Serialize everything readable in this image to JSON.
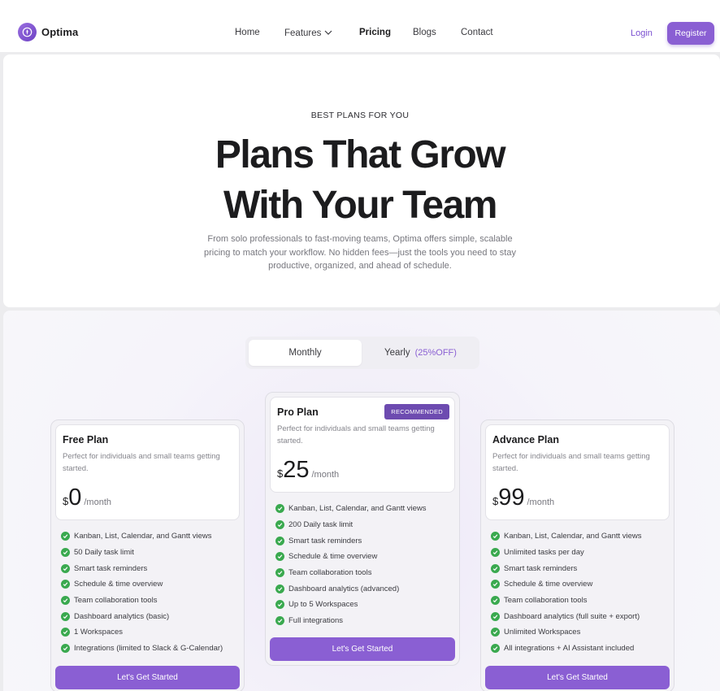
{
  "brand": {
    "name": "Optima",
    "icon": "optima-logo-icon",
    "accent": "#8a5fd3"
  },
  "nav": {
    "items": [
      {
        "label": "Home"
      },
      {
        "label": "Features",
        "icon": "chevron-down-icon"
      },
      {
        "label": "Pricing",
        "active": true
      },
      {
        "label": "Blogs"
      },
      {
        "label": "Contact"
      }
    ],
    "login": "Login",
    "register": "Register"
  },
  "hero": {
    "eyebrow": "BEST PLANS FOR YOU",
    "title_line1": "Plans That Grow",
    "title_line2": "With Your Team",
    "subtitle": "From solo professionals to fast-moving teams, Optima offers simple, scalable pricing to match your workflow. No hidden fees—just the tools you need to stay productive, organized, and ahead of schedule."
  },
  "billing_toggle": {
    "monthly": "Monthly",
    "yearly": "Yearly",
    "yearly_discount": "(25%OFF)",
    "selected": "Monthly"
  },
  "plans": [
    {
      "name": "Free Plan",
      "description": "Perfect for individuals and small teams getting started.",
      "currency": "$",
      "price": "0",
      "period": "/month",
      "features": [
        "Kanban, List, Calendar, and Gantt views",
        "50 Daily task limit",
        "Smart task reminders",
        "Schedule & time overview",
        "Team collaboration tools",
        "Dashboard analytics (basic)",
        "1 Workspaces",
        "Integrations (limited to Slack & G-Calendar)"
      ],
      "cta": "Let's Get Started"
    },
    {
      "name": "Pro Plan",
      "badge": "RECOMMENDED",
      "description": "Perfect for individuals and small teams getting started.",
      "currency": "$",
      "price": "25",
      "period": "/month",
      "features": [
        "Kanban, List, Calendar, and Gantt views",
        "200 Daily task limit",
        "Smart task reminders",
        "Schedule & time overview",
        "Team collaboration tools",
        "Dashboard analytics (advanced)",
        "Up to 5 Workspaces",
        "Full integrations"
      ],
      "cta": "Let's Get Started"
    },
    {
      "name": "Advance Plan",
      "description": "Perfect for individuals and small teams getting started.",
      "currency": "$",
      "price": "99",
      "period": "/month",
      "features": [
        "Kanban, List, Calendar, and Gantt views",
        "Unlimited tasks per day",
        "Smart task reminders",
        "Schedule & time overview",
        "Team collaboration tools",
        "Dashboard analytics (full suite + export)",
        "Unlimited Workspaces",
        "All integrations + AI Assistant included"
      ],
      "cta": "Let's Get Started"
    }
  ]
}
